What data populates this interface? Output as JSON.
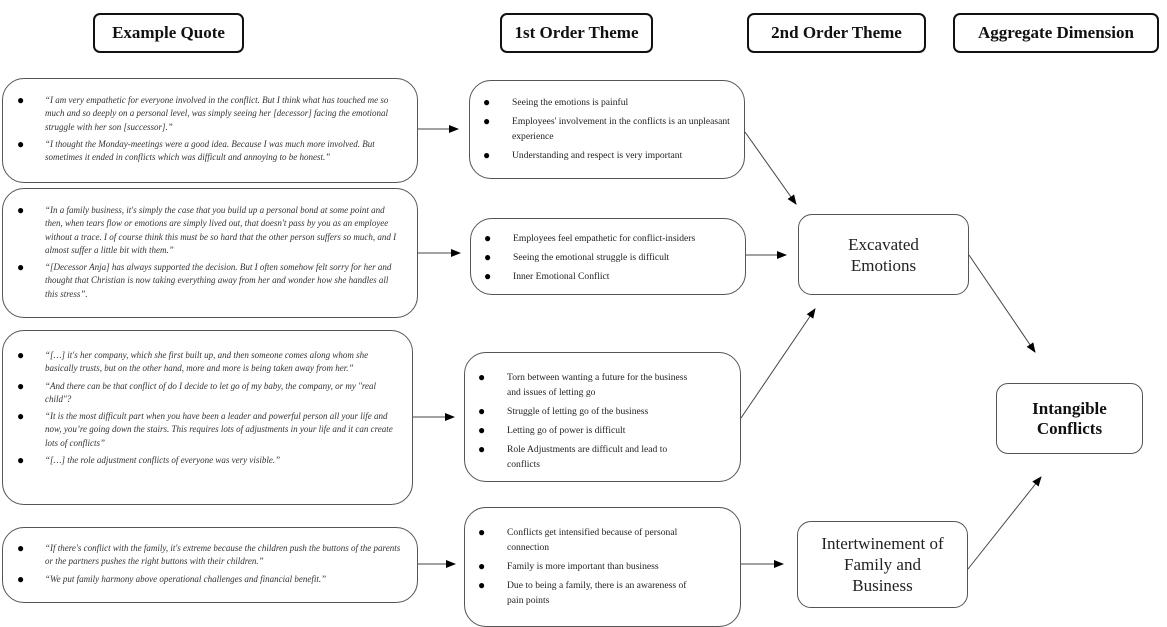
{
  "headers": {
    "example_quote": "Example Quote",
    "first_order": "1st Order Theme",
    "second_order": "2nd Order Theme",
    "aggregate": "Aggregate Dimension"
  },
  "quotes": [
    {
      "items": [
        "“I am very empathetic for everyone involved in the conflict. But I think what has touched me so much and so deeply on a personal level, was simply seeing her [decessor] facing the emotional struggle with her son [successor].”",
        "“I thought the Monday-meetings were a good idea. Because I was much more involved. But sometimes it ended in conflicts which was difficult and annoying to be honest.”"
      ]
    },
    {
      "items": [
        "“In a family business, it's simply the case that you build up a personal bond at some point and then, when tears flow or emotions are simply lived out, that doesn't pass by you as an employee without a trace. I of course think this must be so hard that the other person suffers so much, and I almost suffer a little bit with them.”",
        "“[Decessor Anja] has always supported the decision. But I often somehow felt sorry for her and thought that Christian is now taking everything away from her and wonder how she handles all this stress”."
      ]
    },
    {
      "items": [
        "“[…] it's her company, which she first built up, and then someone comes along whom she basically trusts, but on the other hand, more and more is being taken away from her.”",
        "“And there can be that conflict of do I decide to let go of my baby, the company, or my \"real child\"?",
        "“It is the most difficult part when you have been a leader and powerful person all your life and now, you’re going down the stairs. This requires lots of adjustments in your life and it can create lots of conflicts”",
        "“[…] the role adjustment conflicts of everyone was very visible.”"
      ]
    },
    {
      "items": [
        "“If there's conflict with the family, it's extreme because the children push the buttons of the parents or the partners pushes the right buttons with their children.”",
        "“We put family harmony above operational challenges and financial benefit.”"
      ]
    }
  ],
  "first_order_themes": [
    {
      "items": [
        "Seeing the emotions is painful",
        "Employees' involvement in the conflicts is an unpleasant experience",
        "Understanding and respect is very important"
      ]
    },
    {
      "items": [
        "Employees feel empathetic for conflict-insiders",
        "Seeing the emotional struggle is difficult",
        "Inner Emotional Conflict"
      ]
    },
    {
      "items": [
        "Torn between wanting a future for the business and issues of letting go",
        "Struggle of letting go of the business",
        "Letting go of power is difficult",
        "Role Adjustments are difficult and lead to conflicts"
      ]
    },
    {
      "items": [
        "Conflicts get intensified because of personal connection",
        "Family is more important than business",
        "Due to being a family, there is an awareness of pain points"
      ]
    }
  ],
  "second_order_themes": [
    {
      "line1": "Excavated",
      "line2": "Emotions",
      "line3": ""
    },
    {
      "line1": "Intertwinement of",
      "line2": "Family and",
      "line3": "Business"
    }
  ],
  "aggregate_dimension": {
    "line1": "Intangible",
    "line2": "Conflicts"
  },
  "bullet_glyph": "●"
}
